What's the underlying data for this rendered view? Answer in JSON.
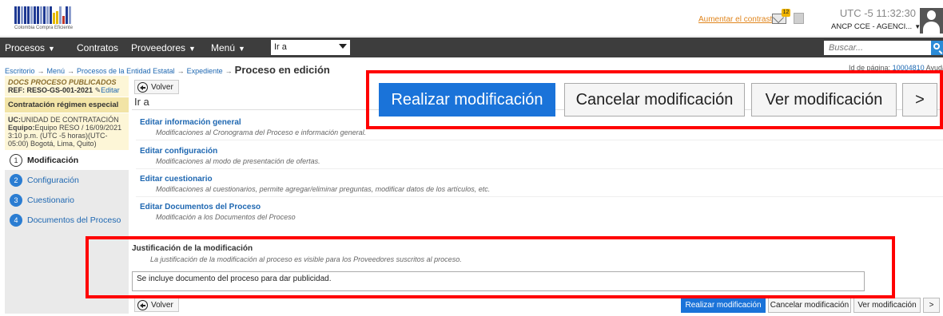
{
  "header": {
    "logo_caption": "Colombia Compra Eficiente",
    "contrast_link": "Aumentar el contraste",
    "mail_count": "12",
    "clock": "UTC -5 11:32:30",
    "user": "ANCP CCE - AGENCI..."
  },
  "nav": {
    "items": [
      "Procesos",
      "Contratos",
      "Proveedores",
      "Menú"
    ],
    "goto_label": "Ir a",
    "search_placeholder": "Buscar..."
  },
  "breadcrumb": {
    "items": [
      "Escritorio",
      "Menú",
      "Procesos de la Entidad Estatal",
      "Expediente"
    ],
    "current": "Proceso en edición",
    "page_id_label": "Id de página:",
    "page_id": "10004810",
    "help": "Ayuda"
  },
  "sidebar": {
    "docs_label": "DOCS PROCESO PUBLICADOS",
    "ref": "REF: RESO-GS-001-2021",
    "edit": "Editar",
    "regime": "Contratación régimen especial",
    "unit_label": "UC:",
    "unit_name": "UNIDAD DE CONTRATACIÓN",
    "team_label": "Equipo:",
    "team_info": "Equipo RESO / 16/09/2021 3:10 p.m. (UTC -5 horas)(UTC-05:00) Bogotá, Lima, Quito)",
    "steps": [
      {
        "num": "1",
        "label": "Modificación"
      },
      {
        "num": "2",
        "label": "Configuración"
      },
      {
        "num": "3",
        "label": "Cuestionario"
      },
      {
        "num": "4",
        "label": "Documentos del Proceso"
      }
    ]
  },
  "main": {
    "back_label": "Volver",
    "goto_label": "Ir a",
    "items": [
      {
        "title": "Editar información general",
        "desc": "Modificaciones al Cronograma del Proceso e información general."
      },
      {
        "title": "Editar configuración",
        "desc": "Modificaciones al modo de presentación de ofertas."
      },
      {
        "title": "Editar cuestionario",
        "desc": "Modificaciones al cuestionarios, permite agregar/eliminar preguntas, modificar datos de los artículos, etc."
      },
      {
        "title": "Editar Documentos del Proceso",
        "desc": "Modificación a los Documentos del Proceso"
      }
    ],
    "justification_title": "Justificación de la modificación",
    "justification_desc": "La justificación de la modificación al proceso es visible para los Proveedores suscritos al proceso.",
    "justification_text": "Se incluye documento del proceso para dar publicidad."
  },
  "actions": {
    "realizar": "Realizar modificación",
    "cancelar": "Cancelar modificación",
    "ver": "Ver modificación",
    "next": ">"
  },
  "colors": {
    "primary": "#1a73d9",
    "navbar": "#3d3d3d",
    "highlight": "#ff0000",
    "link": "#1e67b1"
  }
}
